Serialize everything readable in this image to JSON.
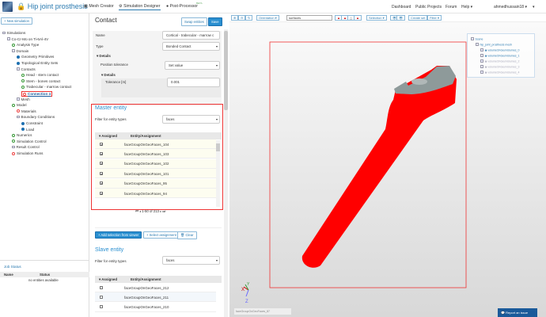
{
  "header": {
    "title": "Hip joint prosthesis",
    "tabs": [
      {
        "label": "Mesh Creator"
      },
      {
        "label": "Simulation Designer",
        "active": true
      },
      {
        "label": "Post-Processor",
        "badge": "BETA"
      }
    ],
    "nav": [
      "Dashboard",
      "Public Projects",
      "Forum",
      "Help ▾",
      "ahmedhussain18 ▾",
      "▾"
    ]
  },
  "left": {
    "new_sim": "+ New simulation",
    "tree": [
      {
        "label": "Simulations",
        "icon": "box",
        "lvl": 0
      },
      {
        "label": "Co-Cr-Mo on Ti-6Al-4V",
        "icon": "box",
        "lvl": 1
      },
      {
        "label": "Analysis Type",
        "icon": "check-green",
        "lvl": 2
      },
      {
        "label": "Domain",
        "icon": "box",
        "lvl": 2
      },
      {
        "label": "Geometry Primitives",
        "icon": "dot-blue",
        "lvl": 3
      },
      {
        "label": "Topological Entity Sets",
        "icon": "dot-blue",
        "lvl": 3
      },
      {
        "label": "Contacts",
        "icon": "box",
        "lvl": 3
      },
      {
        "label": "Head - stem contact",
        "icon": "check-green",
        "lvl": 4
      },
      {
        "label": "Stem - bones contact",
        "icon": "check-green",
        "lvl": 4
      },
      {
        "label": "Trabecular - marrow contact",
        "icon": "check-green",
        "lvl": 4
      },
      {
        "label": "Connection 4",
        "icon": "circle-red",
        "lvl": 4,
        "selected": true
      },
      {
        "label": "Mesh",
        "icon": "box",
        "lvl": 3
      },
      {
        "label": "Model",
        "icon": "check-green",
        "lvl": 2
      },
      {
        "label": "Materials",
        "icon": "circle-red",
        "lvl": 3
      },
      {
        "label": "Boundary Conditions",
        "icon": "box",
        "lvl": 3
      },
      {
        "label": "Constraint",
        "icon": "dot-blue",
        "lvl": 4
      },
      {
        "label": "Load",
        "icon": "dot-blue",
        "lvl": 4
      },
      {
        "label": "Numerics",
        "icon": "check-green",
        "lvl": 2
      },
      {
        "label": "Simulation Control",
        "icon": "check-green",
        "lvl": 2
      },
      {
        "label": "Result Control",
        "icon": "box",
        "lvl": 2
      },
      {
        "label": "Simulation Runs",
        "icon": "circle-red",
        "lvl": 2
      }
    ],
    "job_status": {
      "title": "Job Status",
      "cols": [
        "Name",
        "Status"
      ],
      "empty": "no entities available"
    }
  },
  "contact": {
    "title": "Contact",
    "swap": "Swap entities",
    "save": "Save",
    "name_label": "Name",
    "name_value": "Cortical - trabecular - marrow c",
    "type_label": "Type",
    "type_value": "Bonded Contact",
    "details": "▾ Details",
    "pos_tol_label": "Position tolerance",
    "pos_tol_value": "Set value",
    "details2": "▾ Details",
    "tol_label": "Tolerance [m]",
    "tol_value": "0.001"
  },
  "master": {
    "title": "Master entity",
    "filter_label": "Filter for entity types",
    "filter_value": "faces",
    "col_assigned": "▾ Assigned",
    "col_entity": "Entity/Assignment",
    "rows": [
      "faceGroupOnGeoFaces_104",
      "faceGroupOnGeoFaces_103",
      "faceGroupOnGeoFaces_102",
      "faceGroupOnGeoFaces_101",
      "faceGroupOnGeoFaces_95",
      "faceGroupOnGeoFaces_94"
    ],
    "pagination": "1-50 of 213",
    "add": "+ Add selection from viewer",
    "select": "+ Select assignment",
    "clear": "🗑 Clear"
  },
  "slave": {
    "title": "Slave entity",
    "filter_label": "Filter for entity types",
    "filter_value": "faces",
    "col_assigned": "▾ Assigned",
    "col_entity": "Entity/Assignment",
    "rows": [
      "faceGroupOnGeoFaces_212",
      "faceGroupOnGeoFaces_211",
      "faceGroupOnGeoFaces_210"
    ]
  },
  "viewer": {
    "toolbar": {
      "orientation": "Orientation ▾",
      "render_mode": "surfaces",
      "selection": "Selection ▾",
      "create_set": "Create set",
      "filter": "Filter ▾"
    },
    "scene": {
      "root": "Scene",
      "mesh": "hip_joint_prosthesis mesh",
      "volumes": [
        {
          "label": "volumeOnGeoVolumes_0",
          "visible": true
        },
        {
          "label": "volumeOnGeoVolumes_1",
          "visible": true
        },
        {
          "label": "volumeOnGeoVolumes_2",
          "visible": false
        },
        {
          "label": "volumeOnGeoVolumes_3",
          "visible": false
        },
        {
          "label": "volumeOnGeoVolumes_4",
          "visible": false
        }
      ]
    },
    "hover": "faceGroupOnGeoFaces_87",
    "axes": [
      "X",
      "Y",
      "Z"
    ],
    "report": "Report an issue",
    "colors": {
      "selected": "#ff0000",
      "unselected": "#8e9a9a"
    }
  }
}
